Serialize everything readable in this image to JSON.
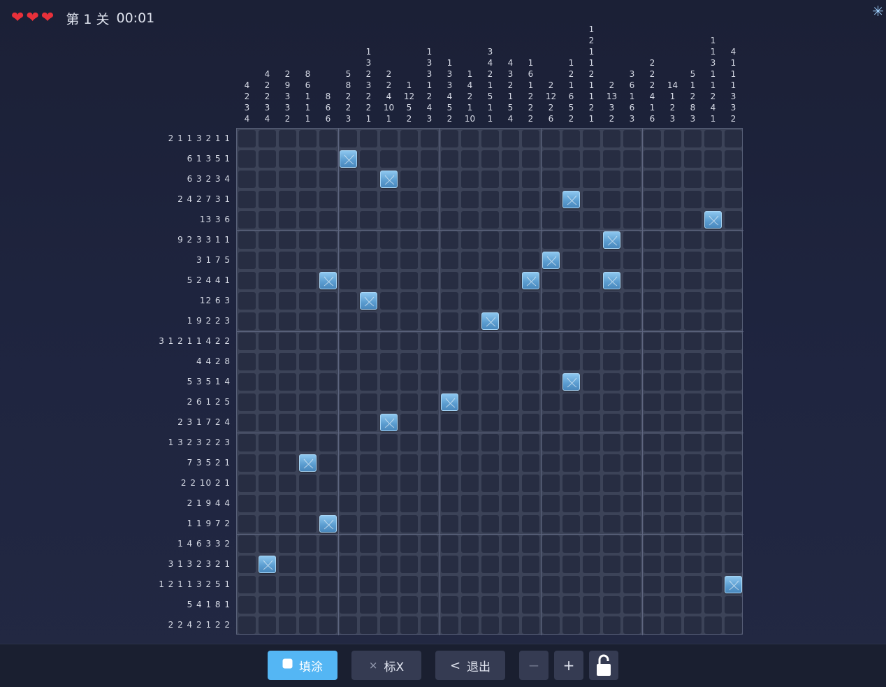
{
  "hud": {
    "lives": 3,
    "heart_glyph": "❤",
    "level_label": "第 1 关",
    "timer": "00:01"
  },
  "corner_icon": "snowflake-icon",
  "grid": {
    "size": 25
  },
  "column_clues": [
    [
      "4",
      "2",
      "3",
      "4"
    ],
    [
      "4",
      "2",
      "2",
      "3",
      "4"
    ],
    [
      "2",
      "9",
      "3",
      "3",
      "2"
    ],
    [
      "8",
      "6",
      "1",
      "1",
      "1"
    ],
    [
      "8",
      "6",
      "6"
    ],
    [
      "5",
      "8",
      "2",
      "2",
      "3"
    ],
    [
      "1",
      "3",
      "2",
      "3",
      "2",
      "2",
      "1"
    ],
    [
      "2",
      "2",
      "4",
      "10",
      "1"
    ],
    [
      "1",
      "12",
      "5",
      "2"
    ],
    [
      "1",
      "3",
      "3",
      "1",
      "2",
      "4",
      "3"
    ],
    [
      "1",
      "3",
      "3",
      "4",
      "5",
      "2"
    ],
    [
      "1",
      "4",
      "2",
      "1",
      "10"
    ],
    [
      "3",
      "4",
      "2",
      "1",
      "5",
      "1",
      "1"
    ],
    [
      "4",
      "3",
      "2",
      "1",
      "5",
      "4"
    ],
    [
      "1",
      "6",
      "1",
      "2",
      "2",
      "2"
    ],
    [
      "2",
      "12",
      "2",
      "6"
    ],
    [
      "1",
      "2",
      "1",
      "6",
      "5",
      "2"
    ],
    [
      "1",
      "2",
      "1",
      "1",
      "2",
      "1",
      "1",
      "2",
      "1"
    ],
    [
      "2",
      "13",
      "3",
      "2"
    ],
    [
      "3",
      "6",
      "1",
      "6",
      "3"
    ],
    [
      "2",
      "2",
      "2",
      "4",
      "1",
      "6"
    ],
    [
      "14",
      "1",
      "2",
      "3"
    ],
    [
      "5",
      "1",
      "2",
      "8",
      "3"
    ],
    [
      "1",
      "1",
      "3",
      "1",
      "1",
      "2",
      "4",
      "1"
    ],
    [
      "4",
      "1",
      "1",
      "1",
      "3",
      "3",
      "2"
    ]
  ],
  "row_clues": [
    "2 1 1 3 2 1 1",
    "6 1 3 5 1",
    "6 3 2 3 4",
    "2 4 2 7 3 1",
    "13 3 6",
    "9 2 3 3 1 1",
    "3 1 7 5",
    "5 2 4 4 1",
    "12 6 3",
    "1 9 2 2 3",
    "3 1 2 1 1 4 2 2",
    "4 4 2 8",
    "5 3 5 1 4",
    "2 6 1 2 5",
    "2 3 1 7 2 4",
    "1 3 2 3 2 2 3",
    "7 3 5 2 1",
    "2 2 10 2 1",
    "2 1 9 4 4",
    "1 1 9 7 2",
    "1 4 6 3 3 2",
    "3 1 3 2 3 2 1",
    "1 2 1 1 3 2 5 1",
    "5 4 1 8 1",
    "2 2 4 2 1 2 2"
  ],
  "marked_cells": [
    [
      1,
      5
    ],
    [
      2,
      7
    ],
    [
      3,
      16
    ],
    [
      4,
      23
    ],
    [
      5,
      18
    ],
    [
      6,
      15
    ],
    [
      7,
      4
    ],
    [
      7,
      14
    ],
    [
      7,
      18
    ],
    [
      8,
      6
    ],
    [
      9,
      12
    ],
    [
      12,
      16
    ],
    [
      13,
      10
    ],
    [
      14,
      7
    ],
    [
      16,
      3
    ],
    [
      19,
      4
    ],
    [
      21,
      1
    ],
    [
      22,
      24
    ]
  ],
  "toolbar": {
    "fill_label": "填涂",
    "mark_label": "标X",
    "mark_glyph": "×",
    "exit_label": "退出",
    "exit_glyph": "<",
    "zoom_out": "−",
    "zoom_in": "+",
    "lock_icon": "unlock-icon"
  },
  "colors": {
    "accent": "#54b6f4",
    "heart": "#e8303a",
    "cell": "#272d42",
    "marked": "#5a9ccf"
  }
}
